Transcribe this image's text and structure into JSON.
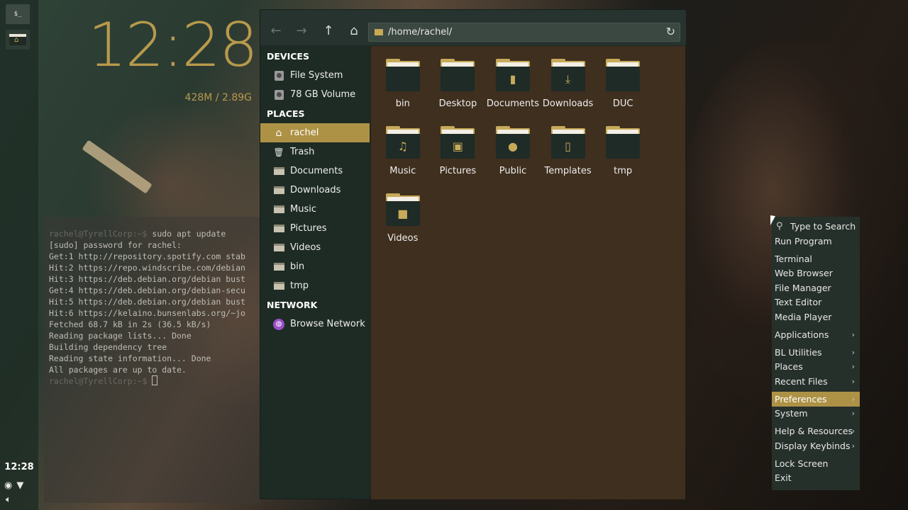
{
  "panel": {
    "terminal_icon": "$_",
    "clock": "12:28"
  },
  "conky": {
    "time": "12:28",
    "memory": "428M / 2.89G"
  },
  "terminal": {
    "lines": [
      {
        "prompt": "rachel@TyrellCorp:~$",
        "text": " sudo apt update"
      },
      {
        "prompt": "",
        "text": "[sudo] password for rachel:"
      },
      {
        "prompt": "",
        "text": "Get:1 http://repository.spotify.com stab"
      },
      {
        "prompt": "",
        "text": "Hit:2 https://repo.windscribe.com/debian"
      },
      {
        "prompt": "",
        "text": "Hit:3 https://deb.debian.org/debian bust"
      },
      {
        "prompt": "",
        "text": "Get:4 https://deb.debian.org/debian-secu"
      },
      {
        "prompt": "",
        "text": "Hit:5 https://deb.debian.org/debian bust"
      },
      {
        "prompt": "",
        "text": "Hit:6 https://kelaino.bunsenlabs.org/~jo"
      },
      {
        "prompt": "",
        "text": "Fetched 68.7 kB in 2s (36.5 kB/s)"
      },
      {
        "prompt": "",
        "text": "Reading package lists... Done"
      },
      {
        "prompt": "",
        "text": "Building dependency tree"
      },
      {
        "prompt": "",
        "text": "Reading state information... Done"
      },
      {
        "prompt": "",
        "text": "All packages are up to date."
      },
      {
        "prompt": "rachel@TyrellCorp:~$",
        "text": " "
      }
    ]
  },
  "filemanager": {
    "path": "/home/rachel/",
    "sidebar": [
      {
        "type": "section",
        "label": "DEVICES"
      },
      {
        "type": "item",
        "label": "File System",
        "icon": "drive-icon"
      },
      {
        "type": "item",
        "label": "78 GB Volume",
        "icon": "drive-icon"
      },
      {
        "type": "section",
        "label": "PLACES"
      },
      {
        "type": "item",
        "label": "rachel",
        "icon": "home-icon",
        "active": true
      },
      {
        "type": "item",
        "label": "Trash",
        "icon": "trash-icon"
      },
      {
        "type": "item",
        "label": "Documents",
        "icon": "folder-icon"
      },
      {
        "type": "item",
        "label": "Downloads",
        "icon": "folder-icon"
      },
      {
        "type": "item",
        "label": "Music",
        "icon": "folder-icon"
      },
      {
        "type": "item",
        "label": "Pictures",
        "icon": "folder-icon"
      },
      {
        "type": "item",
        "label": "Videos",
        "icon": "folder-icon"
      },
      {
        "type": "item",
        "label": "bin",
        "icon": "folder-icon"
      },
      {
        "type": "item",
        "label": "tmp",
        "icon": "folder-icon"
      },
      {
        "type": "section",
        "label": "NETWORK"
      },
      {
        "type": "item",
        "label": "Browse Network",
        "icon": "globe-icon"
      }
    ],
    "files": [
      {
        "label": "bin",
        "glyph": ""
      },
      {
        "label": "Desktop",
        "glyph": ""
      },
      {
        "label": "Documents",
        "glyph": "▮"
      },
      {
        "label": "Downloads",
        "glyph": "⤓"
      },
      {
        "label": "DUC",
        "glyph": ""
      },
      {
        "label": "Music",
        "glyph": "♫"
      },
      {
        "label": "Pictures",
        "glyph": "▣"
      },
      {
        "label": "Public",
        "glyph": "●"
      },
      {
        "label": "Templates",
        "glyph": "▯"
      },
      {
        "label": "tmp",
        "glyph": ""
      },
      {
        "label": "Videos",
        "glyph": "■"
      }
    ]
  },
  "menu": {
    "search_label": "Type to Search",
    "items": [
      {
        "label": "Run Program",
        "submenu": false,
        "gap_before": false
      },
      {
        "label": "Terminal",
        "submenu": false,
        "gap_before": true
      },
      {
        "label": "Web Browser",
        "submenu": false,
        "gap_before": false
      },
      {
        "label": "File Manager",
        "submenu": false,
        "gap_before": false
      },
      {
        "label": "Text Editor",
        "submenu": false,
        "gap_before": false
      },
      {
        "label": "Media Player",
        "submenu": false,
        "gap_before": false
      },
      {
        "label": "Applications",
        "submenu": true,
        "gap_before": true
      },
      {
        "label": "BL Utilities",
        "submenu": true,
        "gap_before": true
      },
      {
        "label": "Places",
        "submenu": true,
        "gap_before": false
      },
      {
        "label": "Recent Files",
        "submenu": true,
        "gap_before": false
      },
      {
        "label": "Preferences",
        "submenu": true,
        "gap_before": true,
        "highlighted": true
      },
      {
        "label": "System",
        "submenu": true,
        "gap_before": false
      },
      {
        "label": "Help & Resources",
        "submenu": true,
        "gap_before": true
      },
      {
        "label": "Display Keybinds",
        "submenu": true,
        "gap_before": false
      },
      {
        "label": "Lock Screen",
        "submenu": false,
        "gap_before": true
      },
      {
        "label": "Exit",
        "submenu": false,
        "gap_before": false
      }
    ]
  },
  "colors": {
    "accent": "#ad9246",
    "folder_front": "#1f2b26",
    "content_bg": "#3f2f1e"
  }
}
